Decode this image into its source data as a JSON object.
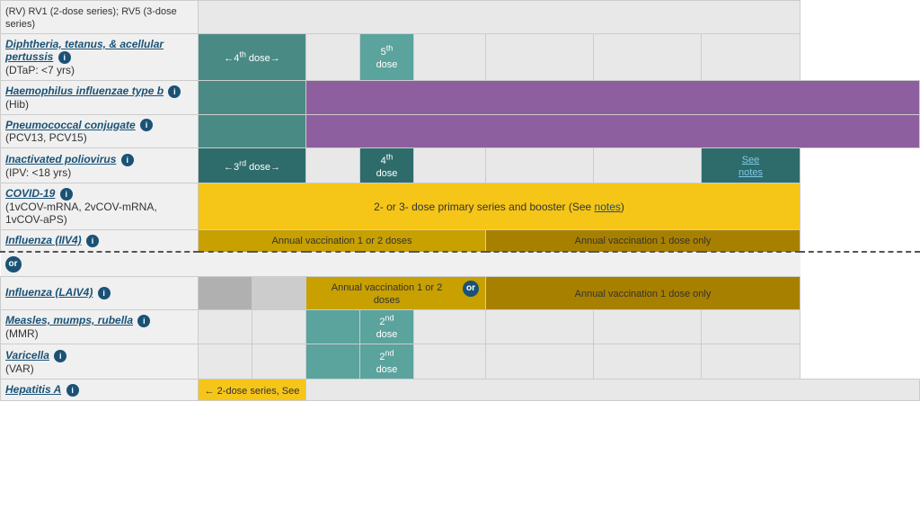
{
  "rows": [
    {
      "id": "rv",
      "name": "(RV) RV1 (2-dose series); RV5 (3-dose series)",
      "nameLink": false,
      "nameLinkText": "",
      "sub": "",
      "infoIcon": false,
      "topStrip": true,
      "cells": []
    },
    {
      "id": "dtap",
      "name": "Diphtheria, tetanus, & acellular pertussis",
      "nameLink": true,
      "sub": "(DTaP: <7 yrs)",
      "infoIcon": true,
      "cells": [
        {
          "text": "←4th dose→",
          "color": "teal",
          "colspan": 2,
          "rowspan": 1
        },
        {
          "text": "",
          "color": "empty",
          "colspan": 1
        },
        {
          "text": "5th\ndose",
          "color": "teal-light",
          "colspan": 1
        },
        {
          "text": "",
          "color": "empty",
          "colspan": 1
        },
        {
          "text": "",
          "color": "empty",
          "colspan": 1
        },
        {
          "text": "",
          "color": "empty",
          "colspan": 1
        },
        {
          "text": "",
          "color": "empty",
          "colspan": 1
        }
      ]
    },
    {
      "id": "hib",
      "name": "Haemophilus influenzae type b",
      "nameLink": true,
      "sub": "(Hib)",
      "infoIcon": true,
      "cells": [
        {
          "text": "",
          "color": "teal",
          "colspan": 2
        },
        {
          "text": "",
          "color": "purple",
          "colspan": 7
        }
      ]
    },
    {
      "id": "pcv",
      "name": "Pneumococcal conjugate",
      "nameLink": true,
      "sub": "(PCV13, PCV15)",
      "infoIcon": true,
      "cells": [
        {
          "text": "",
          "color": "teal",
          "colspan": 2
        },
        {
          "text": "",
          "color": "purple",
          "colspan": 7
        }
      ]
    },
    {
      "id": "ipv",
      "name": "Inactivated poliovirus",
      "nameLink": true,
      "sub": "(IPV: <18 yrs)",
      "infoIcon": true,
      "cells": [
        {
          "text": "←3rd dose→",
          "color": "dark-teal",
          "colspan": 2
        },
        {
          "text": "",
          "color": "empty",
          "colspan": 1
        },
        {
          "text": "4th\ndose",
          "color": "dark-teal",
          "colspan": 1
        },
        {
          "text": "",
          "color": "empty",
          "colspan": 1
        },
        {
          "text": "",
          "color": "empty",
          "colspan": 1
        },
        {
          "text": "",
          "color": "empty",
          "colspan": 1
        },
        {
          "text": "See\nnotes",
          "color": "dark-teal",
          "colspan": 1
        }
      ]
    },
    {
      "id": "covid",
      "name": "COVID-19",
      "nameLink": true,
      "sub": "(1vCOV-mRNA, 2vCOV-mRNA, 1vCOV-aPS)",
      "infoIcon": true,
      "cells": [
        {
          "text": "2- or 3- dose primary series and booster (See notes)",
          "color": "yellow",
          "colspan": 9,
          "hasNotesLink": true
        }
      ]
    },
    {
      "id": "influenza-iiv4",
      "name": "Influenza (IIV4)",
      "nameLink": true,
      "sub": "",
      "infoIcon": true,
      "isDashed": true,
      "cells": [
        {
          "text": "Annual vaccination 1 or 2 doses",
          "color": "gold",
          "colspan": 5
        },
        {
          "text": "Annual vaccination 1 dose only",
          "color": "gold-dark",
          "colspan": 4
        }
      ]
    },
    {
      "id": "influenza-laiv4",
      "name": "Influenza (LAIV4)",
      "nameLink": true,
      "sub": "",
      "infoIcon": true,
      "orRow": true,
      "cells": [
        {
          "text": "",
          "color": "gray-cell",
          "colspan": 1
        },
        {
          "text": "",
          "color": "gray-light",
          "colspan": 1
        },
        {
          "text": "Annual vaccination 1 or 2\ndoses",
          "color": "gold",
          "colspan": 3,
          "hasOrBadge": true
        },
        {
          "text": "Annual vaccination 1 dose only",
          "color": "gold-dark",
          "colspan": 4
        }
      ]
    },
    {
      "id": "mmr",
      "name": "Measles, mumps, rubella",
      "nameLink": true,
      "sub": "(MMR)",
      "infoIcon": true,
      "cells": [
        {
          "text": "",
          "color": "empty",
          "colspan": 1
        },
        {
          "text": "",
          "color": "empty",
          "colspan": 1
        },
        {
          "text": "",
          "color": "teal-light",
          "colspan": 1
        },
        {
          "text": "2nd\ndose",
          "color": "teal-light",
          "colspan": 1
        },
        {
          "text": "",
          "color": "empty",
          "colspan": 1
        },
        {
          "text": "",
          "color": "empty",
          "colspan": 1
        },
        {
          "text": "",
          "color": "empty",
          "colspan": 1
        },
        {
          "text": "",
          "color": "empty",
          "colspan": 1
        }
      ]
    },
    {
      "id": "varicella",
      "name": "Varicella",
      "nameLink": true,
      "sub": "(VAR)",
      "infoIcon": true,
      "cells": [
        {
          "text": "",
          "color": "empty",
          "colspan": 1
        },
        {
          "text": "",
          "color": "empty",
          "colspan": 1
        },
        {
          "text": "",
          "color": "teal-light",
          "colspan": 1
        },
        {
          "text": "2nd\ndose",
          "color": "teal-light",
          "colspan": 1
        },
        {
          "text": "",
          "color": "empty",
          "colspan": 1
        },
        {
          "text": "",
          "color": "empty",
          "colspan": 1
        },
        {
          "text": "",
          "color": "empty",
          "colspan": 1
        },
        {
          "text": "",
          "color": "empty",
          "colspan": 1
        }
      ]
    },
    {
      "id": "hepa",
      "name": "Hepatitis A",
      "nameLink": true,
      "sub": "",
      "infoIcon": true,
      "cells": [
        {
          "text": "← 2-dose series, See",
          "color": "yellow",
          "colspan": 2
        },
        {
          "text": "",
          "color": "empty",
          "colspan": 7
        }
      ]
    }
  ],
  "colors": {
    "teal": "#4a8a85",
    "teal_light": "#5ba39d",
    "dark_teal": "#2e6b6b",
    "purple": "#8e5f9e",
    "gray": "#b0b0b0",
    "gray_light": "#cccccc",
    "yellow": "#f5c518",
    "gold": "#c8a000",
    "gold_dark": "#a88000",
    "empty": "#e8e8e8",
    "background": "#f0f0f0"
  },
  "labels": {
    "see_notes": "notes",
    "or": "or",
    "annual_1_2": "Annual vaccination 1 or 2 doses",
    "annual_1_2_laiv": "Annual vaccination 1 or 2\ndoses",
    "annual_1_only": "Annual vaccination 1 dose only",
    "covid_text": "2- or 3- dose primary series and booster (See notes)",
    "hepa_text": "← 2-dose series, See"
  }
}
